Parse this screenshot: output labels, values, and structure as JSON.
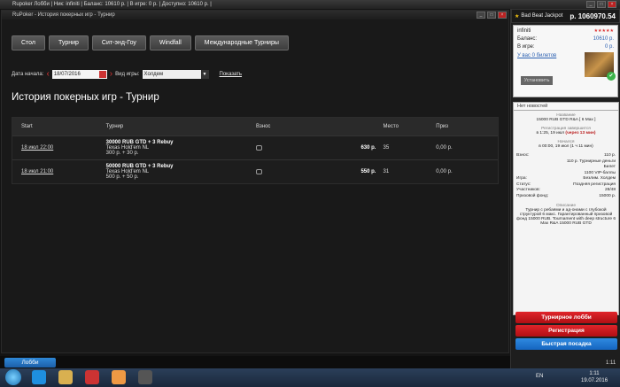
{
  "window": {
    "lobby_title": "Rupoker Лобби | Ник: infiniti | Баланс: 10610 р. | В игре: 0 р. | Доступно: 10610 р. |",
    "history_title": "RuPoker - История покерных игр - Турнир"
  },
  "tabs": [
    "Стол",
    "Турнир",
    "Сит-энд-Гоу",
    "Windfall",
    "Международные Турниры"
  ],
  "filters": {
    "date_label": "Дата начала:",
    "date_value": "18/07/2016",
    "game_type_label": "Вид игры:",
    "game_type_value": "Холдем",
    "show_link": "Показать"
  },
  "page_title": "История покерных игр - Турнир",
  "table": {
    "headers": [
      "Start",
      "Турнир",
      "Взнос",
      "",
      "Место",
      "Приз"
    ],
    "rows": [
      {
        "start": "18 июл 22:00",
        "name": "30000 RUB GTD + 3 Rebuy",
        "game": "Texas Hold'em NL",
        "buyin_detail": "300 р. + 30 р.",
        "amount": "630 р.",
        "place": "35",
        "prize": "0,00 р."
      },
      {
        "start": "18 июл 21:00",
        "name": "50000 RUB GTD + 3 Rebuy",
        "game": "Texas Hold'em NL",
        "buyin_detail": "500 р. + 50 р.",
        "amount": "550 р.",
        "place": "31",
        "prize": "0,00 р."
      }
    ]
  },
  "lobby_button": "Лобби",
  "jackpot": {
    "label": "Bad Beat Jackpot",
    "value": "р. 1060970.54"
  },
  "account": {
    "nick": "infiniti",
    "balance_label": "Баланс:",
    "balance_value": "10610 р.",
    "ingame_label": "В игре:",
    "ingame_value": "0 р.",
    "tickets": "У вас 0 билетов",
    "setup_button": "Установить",
    "news": "Нет новостей"
  },
  "tournament_info": {
    "name_label": "Название",
    "name_value": "15000 RUB GTD R&A [ 6 Max ]",
    "reg_end_label": "Регистрация завершится",
    "reg_end_value": "в 1:25, 19 июл",
    "reg_end_rel": "(через 13 мин)",
    "start_label": "Начался",
    "start_value": "в 00:00, 19 июл (1 ч 11 мин)",
    "buyin_label": "Взнос:",
    "buyin_value": "110 р.",
    "buyin_alt1": "110 р. Турнирные деньги",
    "buyin_alt2": "Билет",
    "buyin_alt3": "1100 VIP-баллы",
    "game_label": "Игра:",
    "game_value": "Безлим. Холдем",
    "status_label": "Статус:",
    "status_value": "Поздняя регистрация",
    "players_label": "Участников:",
    "players_value": "28/48",
    "prize_label": "Призовой фонд:",
    "prize_value": "15000 р.",
    "desc_label": "Описание",
    "desc_value": "Турнир с ребаями и ад-онами с глубокой структурой 6 макс. Гарантированный призовой фонд 15000 RUB. Tournament with deep structure 6 Max R&A 15000 RUB GTD"
  },
  "actions": {
    "lobby": "Турнирное лобби",
    "register": "Регистрация",
    "quick": "Быстрая посадка"
  },
  "tray": {
    "time_small": "1:11",
    "lang": "EN",
    "clock_time": "1:11",
    "clock_date": "19.07.2016"
  }
}
